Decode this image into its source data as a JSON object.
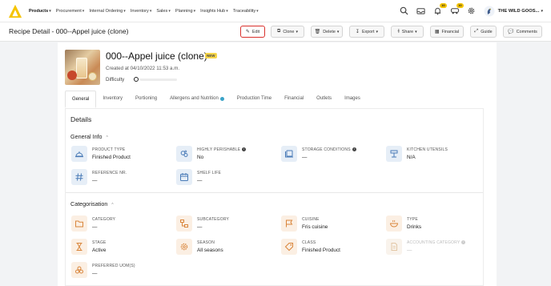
{
  "nav": {
    "items": [
      {
        "label": "Products",
        "active": true
      },
      {
        "label": "Procurement",
        "active": false
      },
      {
        "label": "Internal Ordering",
        "active": false
      },
      {
        "label": "Inventory",
        "active": false
      },
      {
        "label": "Sales",
        "active": false
      },
      {
        "label": "Planning",
        "active": false
      },
      {
        "label": "Insights Hub",
        "active": false
      },
      {
        "label": "Traceability",
        "active": false
      }
    ],
    "badge_notifications": "10",
    "badge_deliveries": "10",
    "org_name": "THE WILD GOOS...",
    "accent_color": "#f5c400"
  },
  "header": {
    "title": "Recipe Detail - 000--Appel juice (clone)",
    "buttons": {
      "edit": "Edit",
      "clone": "Clone",
      "delete": "Delete",
      "export": "Export",
      "share": "Share",
      "financial": "Financial",
      "guide": "Guide",
      "comments": "Comments"
    }
  },
  "recipe": {
    "name": "000--Appel juice (clone)",
    "badge": "NEW",
    "created": "Created at 04/10/2022 11:53 a.m.",
    "difficulty_label": "Difficulty"
  },
  "tabs": [
    "General",
    "Inventory",
    "Portioning",
    "Allergens and Nutrition",
    "Production Time",
    "Financial",
    "Outlets",
    "Images"
  ],
  "details": {
    "title": "Details",
    "general_info": {
      "title": "General Info",
      "fields": {
        "product_type": {
          "label": "PRODUCT TYPE",
          "value": "Finished Product"
        },
        "highly_perishable": {
          "label": "HIGHLY PERISHABLE",
          "value": "No"
        },
        "storage_conditions": {
          "label": "STORAGE CONDITIONS",
          "value": "—"
        },
        "kitchen_utensils": {
          "label": "KITCHEN UTENSILS",
          "value": "N/A"
        },
        "reference_nr": {
          "label": "REFERENCE NR.",
          "value": "—"
        },
        "shelf_life": {
          "label": "SHELF LIFE",
          "value": "—"
        }
      }
    },
    "categorisation": {
      "title": "Categorisation",
      "fields": {
        "category": {
          "label": "CATEGORY",
          "value": "—"
        },
        "subcategory": {
          "label": "SUBCATEGORY",
          "value": "—"
        },
        "cuisine": {
          "label": "CUISINE",
          "value": "Fris cuisine"
        },
        "type": {
          "label": "TYPE",
          "value": "Drinks"
        },
        "stage": {
          "label": "STAGE",
          "value": "Active"
        },
        "season": {
          "label": "SEASON",
          "value": "All seasons"
        },
        "class": {
          "label": "CLASS",
          "value": "Finished Product"
        },
        "accounting_category": {
          "label": "ACCOUNTING CATEGORY",
          "value": "—"
        },
        "preferred_uoms": {
          "label": "PREFERRED UOM(S)",
          "value": "—"
        }
      }
    }
  }
}
